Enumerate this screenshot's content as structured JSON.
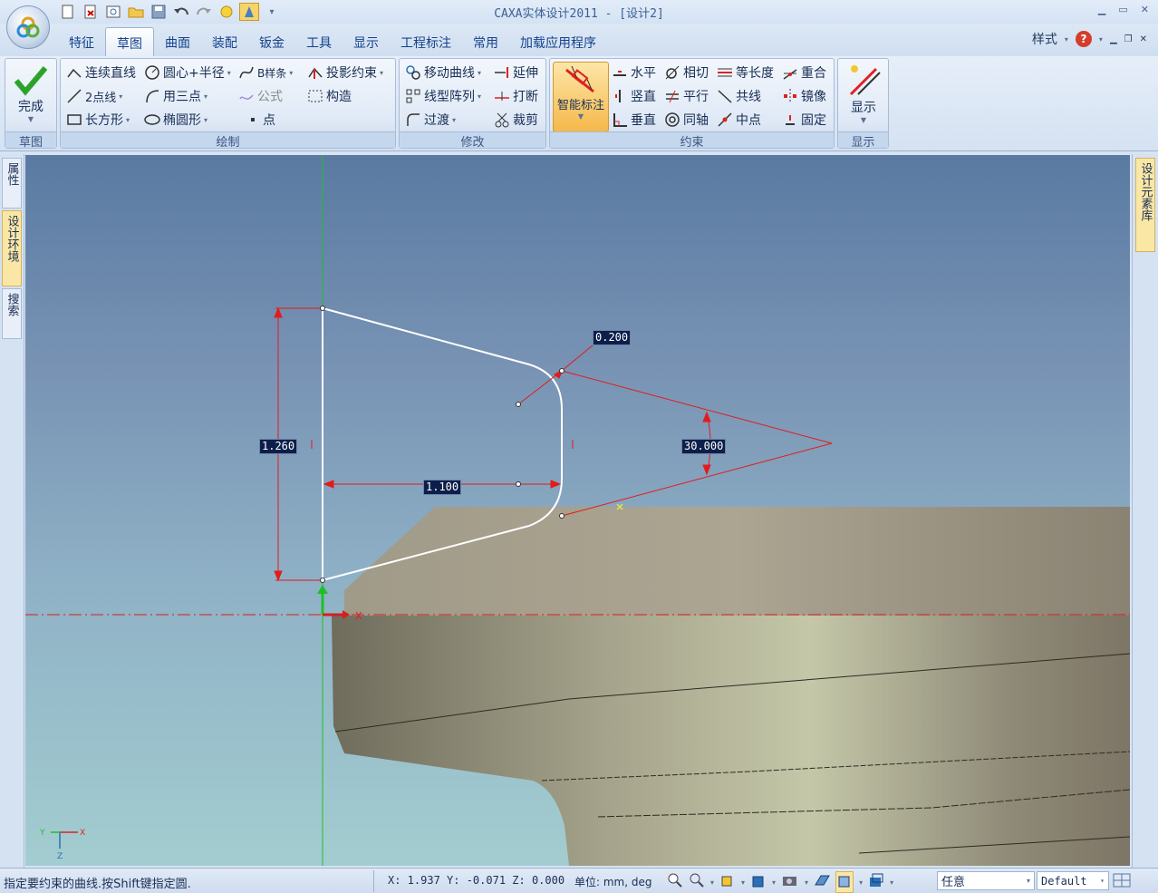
{
  "window": {
    "title": "CAXA实体设计2011 - [设计2]"
  },
  "qat": {
    "icons": [
      "new-icon",
      "open-icon",
      "image-icon",
      "folder-icon",
      "save-icon",
      "undo-icon",
      "redo-icon",
      "lightbulb-icon",
      "tree-icon",
      "qat-menu-icon"
    ]
  },
  "tabs": [
    "特征",
    "草图",
    "曲面",
    "装配",
    "钣金",
    "工具",
    "显示",
    "工程标注",
    "常用",
    "加载应用程序"
  ],
  "active_tab": "草图",
  "style_menu": {
    "label": "样式"
  },
  "ribbon": {
    "sketch_group": {
      "label": "草图",
      "finish": "完成"
    },
    "draw_group": {
      "label": "绘制",
      "items": [
        "连续直线",
        "2点线",
        "长方形",
        "圆心+半径",
        "用三点",
        "椭圆形",
        "B样条",
        "公式",
        "点",
        "投影约束",
        "构造"
      ]
    },
    "modify_group": {
      "label": "修改",
      "items": [
        "移动曲线",
        "线型阵列",
        "过渡",
        "延伸",
        "打断",
        "裁剪"
      ]
    },
    "constraint_group": {
      "label": "约束",
      "smart": "智能标注",
      "items": [
        "水平",
        "竖直",
        "垂直",
        "相切",
        "平行",
        "同轴",
        "等长度",
        "共线",
        "中点",
        "重合",
        "镜像",
        "固定"
      ]
    },
    "display_group": {
      "label": "显示",
      "display": "显示"
    }
  },
  "left_tabs": [
    "属性",
    "设计环境",
    "搜索"
  ],
  "right_tabs": [
    "设计元素库"
  ],
  "viewport": {
    "dimensions": {
      "d1": "1.260",
      "d2": "1.100",
      "d3": "0.200",
      "d4": "30.000"
    },
    "axis_x": "X",
    "triad": {
      "x": "X",
      "y": "Y",
      "z": "Z"
    }
  },
  "colors": {
    "sketch": "#ffffff",
    "dimension": "#e21b1b",
    "axis_green": "#1fbf2a",
    "part": "#a9a392"
  },
  "status": {
    "message": "指定要约束的曲线.按Shift键指定圆.",
    "coords": "X: 1.937 Y: -0.071 Z: 0.000",
    "unit": "单位: mm, deg",
    "select_mode": "任意",
    "style_value": "Default"
  }
}
